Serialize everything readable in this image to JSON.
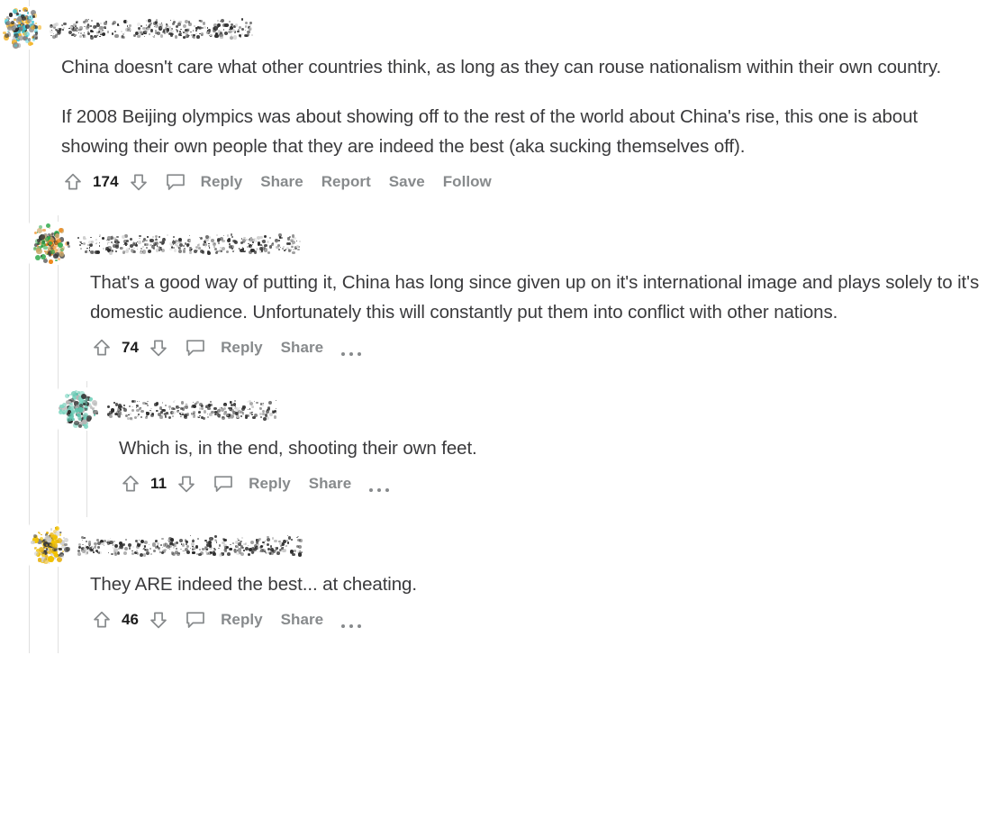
{
  "page": {
    "type": "reddit-comment-thread",
    "background_color": "#ffffff",
    "body_text_color": "#3a3a3c",
    "action_label_color": "#878a8c",
    "score_color": "#1c1c1c",
    "thread_line_color": "#e0e0e0"
  },
  "icons": {
    "upvote": "upvote-arrow-icon",
    "downvote": "downvote-arrow-icon",
    "comment": "comment-bubble-icon",
    "overflow": "overflow-dots-icon"
  },
  "comments": [
    {
      "depth": 0,
      "username": "",
      "username_state": "redacted",
      "avatar_state": "redacted",
      "avatar_colors": [
        "#3ec8d8",
        "#f3b62c",
        "#8a8a8a",
        "#2c2c2c"
      ],
      "paragraphs": [
        "China doesn't care what other countries think, as long as they can rouse nationalism within their own country.",
        "If 2008 Beijing olympics was about showing off to the rest of the world about China's rise, this one is about showing their own people that they are indeed the best (aka sucking themselves off)."
      ],
      "score": "174",
      "actions": [
        "Reply",
        "Share",
        "Report",
        "Save",
        "Follow"
      ],
      "has_overflow": false
    },
    {
      "depth": 1,
      "username": "",
      "username_state": "redacted",
      "avatar_state": "redacted",
      "avatar_colors": [
        "#f08a1e",
        "#c9a86a",
        "#2ea84a",
        "#3a3a3a"
      ],
      "paragraphs": [
        "That's a good way of putting it, China has long since given up on it's international image and plays solely to it's domestic audience. Unfortunately this will constantly put them into conflict with other nations."
      ],
      "score": "74",
      "actions": [
        "Reply",
        "Share"
      ],
      "has_overflow": true
    },
    {
      "depth": 2,
      "username": "",
      "username_state": "redacted",
      "avatar_state": "redacted",
      "avatar_colors": [
        "#5fc3ad",
        "#7fd6c2",
        "#2c2c2c",
        "#b5b5b5"
      ],
      "paragraphs": [
        "Which is, in the end, shooting their own feet."
      ],
      "score": "11",
      "actions": [
        "Reply",
        "Share"
      ],
      "has_overflow": true
    },
    {
      "depth": 1,
      "username": "",
      "username_state": "redacted",
      "avatar_state": "redacted",
      "avatar_colors": [
        "#f2c200",
        "#e8b417",
        "#3a3a3a",
        "#cccccc"
      ],
      "paragraphs": [
        "They ARE indeed the best... at cheating."
      ],
      "score": "46",
      "actions": [
        "Reply",
        "Share"
      ],
      "has_overflow": true
    }
  ]
}
